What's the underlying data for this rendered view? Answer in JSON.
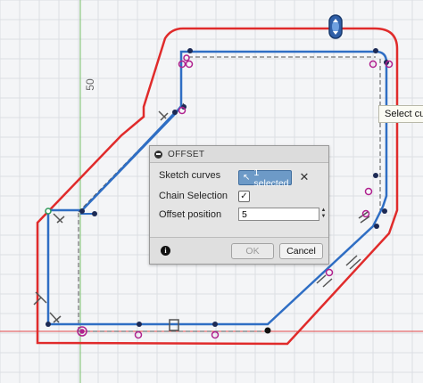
{
  "canvas": {
    "dimension_label": "50",
    "colors": {
      "background": "#f4f5f7",
      "grid": "#dadde1",
      "sketch_line": "#2f6ec4",
      "offset_curve": "#e02b2b",
      "constraint_point": "#b0208e",
      "axis_green": "#78c06a",
      "axis_red": "#e24848"
    }
  },
  "tooltip": {
    "text": "Select cu"
  },
  "dialog": {
    "title": "OFFSET",
    "sketch_curves_label": "Sketch curves",
    "selection_value": "1 selected",
    "chain_selection_label": "Chain Selection",
    "chain_selection_checked": true,
    "offset_position_label": "Offset position",
    "offset_position_value": "5",
    "ok_label": "OK",
    "cancel_label": "Cancel",
    "icons": {
      "collapse": "minus-circle-icon",
      "cursor": "pointer-cursor-icon",
      "clear": "close-icon",
      "check": "checkmark-icon",
      "info": "info-icon"
    }
  }
}
